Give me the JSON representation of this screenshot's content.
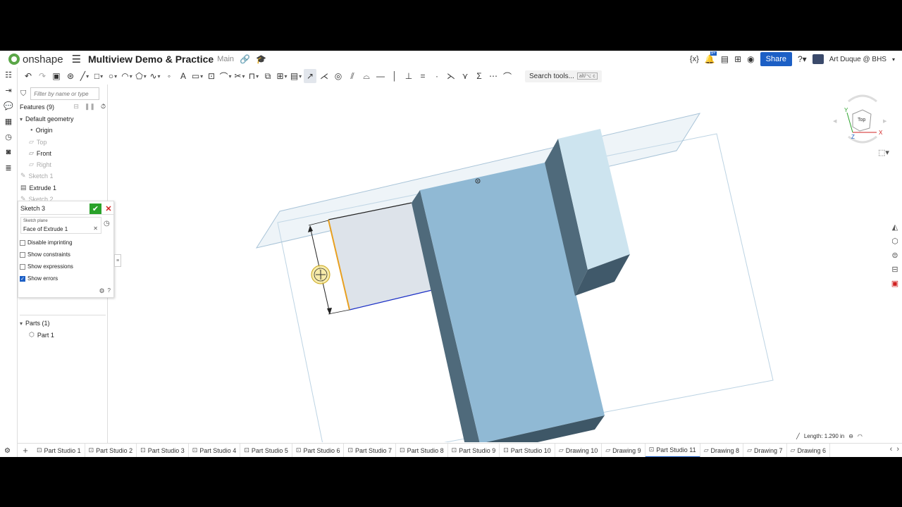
{
  "app": {
    "name": "onshape",
    "doc_title": "Multiview Demo & Practice",
    "branch": "Main"
  },
  "header_right": {
    "share_label": "Share",
    "user_name": "Art Duque @ BHS",
    "notif_count": "9+"
  },
  "toolbar": {
    "search_label": "Search tools...",
    "search_shortcut": "alt/⌥ c"
  },
  "feature_panel": {
    "filter_placeholder": "Filter by name or type",
    "features_title": "Features (9)",
    "tree": [
      {
        "label": "Default geometry"
      },
      {
        "label": "Origin"
      },
      {
        "label": "Top"
      },
      {
        "label": "Front"
      },
      {
        "label": "Right"
      },
      {
        "label": "Sketch 1"
      },
      {
        "label": "Extrude 1"
      },
      {
        "label": "Sketch 2"
      }
    ],
    "parts_title": "Parts (1)",
    "parts": [
      {
        "label": "Part 1"
      }
    ]
  },
  "sketch_dialog": {
    "title": "Sketch 3",
    "plane_label": "Sketch plane",
    "plane_value": "Face of Extrude 1",
    "options": [
      {
        "label": "Disable imprinting",
        "checked": false
      },
      {
        "label": "Show constraints",
        "checked": false
      },
      {
        "label": "Show expressions",
        "checked": false
      },
      {
        "label": "Show errors",
        "checked": true
      }
    ]
  },
  "view_cube": {
    "face_label": "Top",
    "axis_x": "X",
    "axis_y": "Y",
    "axis_z": "Z"
  },
  "status_bar": {
    "length_label": "Length: 1.290 in"
  },
  "tabs": [
    {
      "label": "Part Studio 1",
      "type": "part"
    },
    {
      "label": "Part Studio 2",
      "type": "part"
    },
    {
      "label": "Part Studio 3",
      "type": "part"
    },
    {
      "label": "Part Studio 4",
      "type": "part"
    },
    {
      "label": "Part Studio 5",
      "type": "part"
    },
    {
      "label": "Part Studio 6",
      "type": "part"
    },
    {
      "label": "Part Studio 7",
      "type": "part"
    },
    {
      "label": "Part Studio 8",
      "type": "part"
    },
    {
      "label": "Part Studio 9",
      "type": "part"
    },
    {
      "label": "Part Studio 10",
      "type": "part"
    },
    {
      "label": "Drawing 10",
      "type": "drawing"
    },
    {
      "label": "Drawing 9",
      "type": "drawing"
    },
    {
      "label": "Part Studio 11",
      "type": "part",
      "active": true
    },
    {
      "label": "Drawing 8",
      "type": "drawing"
    },
    {
      "label": "Drawing 7",
      "type": "drawing"
    },
    {
      "label": "Drawing 6",
      "type": "drawing"
    }
  ],
  "colors": {
    "accent": "#1c5fc5",
    "part_face": "#8fb8d4",
    "part_dark": "#4e6a7c",
    "confirm": "#2aa22a",
    "cancel": "#d02020"
  }
}
